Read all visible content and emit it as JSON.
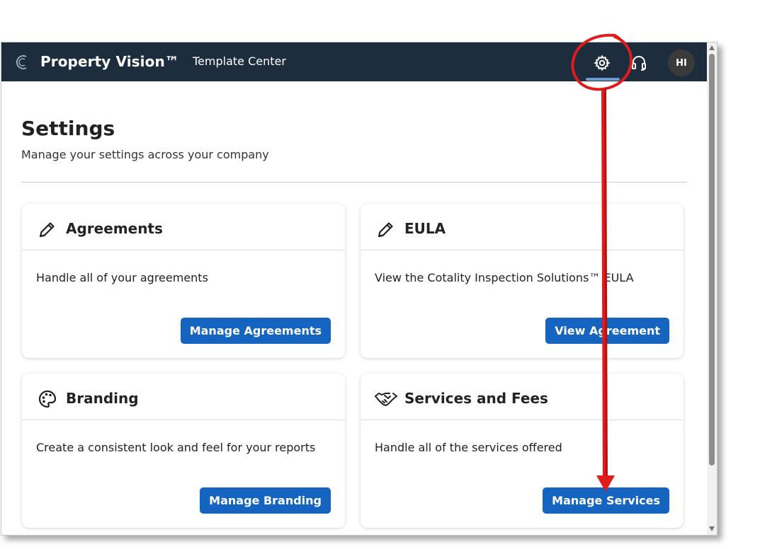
{
  "header": {
    "brand": "Property Vision™",
    "nav_link": "Template Center",
    "avatar_initials": "HI"
  },
  "page": {
    "title": "Settings",
    "subtitle": "Manage your settings across your company"
  },
  "cards": [
    {
      "title": "Agreements",
      "icon": "pencil-icon",
      "description": "Handle all of your agreements",
      "button": "Manage Agreements"
    },
    {
      "title": "EULA",
      "icon": "pencil-icon",
      "description": "View the Cotality Inspection Solutions™ EULA",
      "button": "View Agreement"
    },
    {
      "title": "Branding",
      "icon": "palette-icon",
      "description": "Create a consistent look and feel for your reports",
      "button": "Manage Branding"
    },
    {
      "title": "Services and Fees",
      "icon": "handshake-icon",
      "description": "Handle all of the services offered",
      "button": "Manage Services"
    }
  ],
  "colors": {
    "topbar": "#1e2d3d",
    "button": "#1565c0",
    "annotation": "#e01b1b"
  }
}
